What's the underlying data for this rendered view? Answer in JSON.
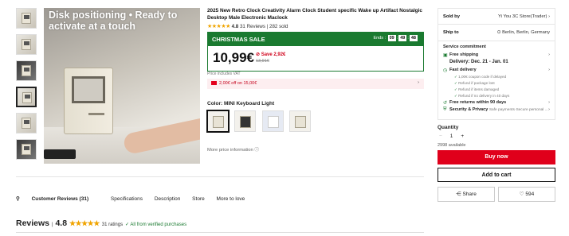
{
  "gallery": {
    "caption_line1": "Disk positioning  •  Ready to",
    "caption_line2": "activate at a touch",
    "thumb_count": 6
  },
  "product": {
    "title": "2025 New Retro Clock Creativity Alarm Clock Student specific Wake up Artifact Nostalgic Desktop Male Electronic Maclock",
    "rating": "4.8",
    "reviews": "31 Reviews",
    "sold": "282 sold"
  },
  "sale": {
    "label": "CHRISTMAS SALE",
    "ends_label": "Ends :",
    "h": "09",
    "m": "49",
    "s": "48",
    "price": "10,99€",
    "save": "Save 2,92€",
    "old_price": "13,91€",
    "vat": "Price includes VAT",
    "coupon": "2,00€ off on 15,00€"
  },
  "color": {
    "label": "Color: MINI Keyboard Light",
    "more_info": "More price information"
  },
  "tabs": {
    "reviews": "Customer Reviews (31)",
    "specs": "Specifications",
    "description": "Description",
    "store": "Store",
    "more": "More to love"
  },
  "reviews_section": {
    "heading": "Reviews",
    "score": "4.8",
    "ratings": "31 ratings",
    "verified": "All from verified purchases"
  },
  "sidebar": {
    "sold_by_label": "Sold by",
    "sold_by_value": "Yi You 3C Store(Trader)",
    "ship_to_label": "Ship to",
    "ship_to_value": "Berlin, Berlin, Germany",
    "service_label": "Service commitment",
    "free_shipping": "Free shipping",
    "delivery_date": "Delivery: Dec. 21 - Jan. 01",
    "fast_delivery": "Fast delivery",
    "fd1": "1,00€ coupon code if delayed",
    "fd2": "Refund if package lost",
    "fd3": "Refund if items damaged",
    "fd4": "Refund if no delivery in 40 days",
    "free_returns": "Free returns within 90 days",
    "security": "Security & Privacy",
    "security_sub": "Safe payments·Secure personal ...",
    "quantity_label": "Quantity",
    "quantity_value": "1",
    "available": "2998 available",
    "buy_now": "Buy now",
    "add_to_cart": "Add to cart",
    "share": "Share",
    "likes": "594"
  },
  "colors": {
    "brand_red": "#e0001b",
    "sale_green": "#1a7a30",
    "star": "#f0a400"
  }
}
